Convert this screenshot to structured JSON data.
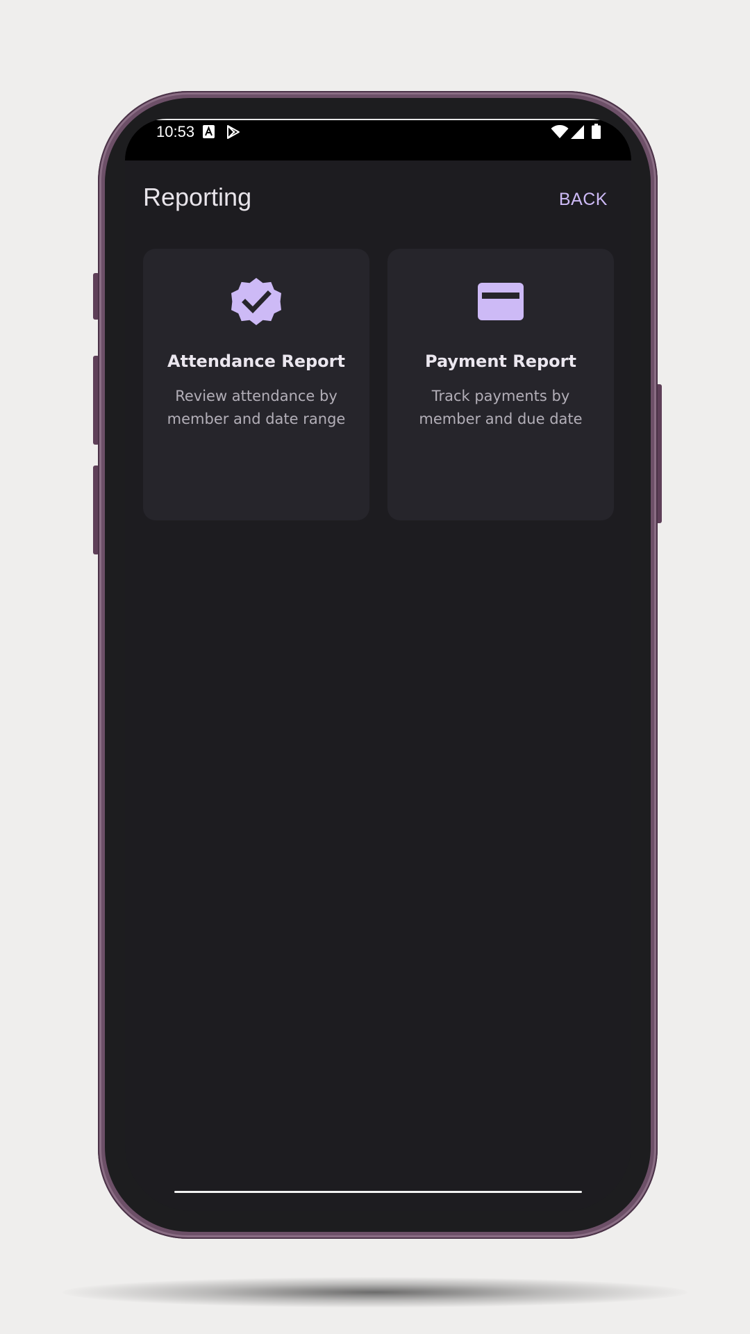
{
  "status_bar": {
    "time": "10:53",
    "left_icons": [
      "font-a-icon",
      "play-store-icon"
    ],
    "right_icons": [
      "wifi-icon",
      "cell-signal-icon",
      "battery-icon"
    ]
  },
  "app_bar": {
    "title": "Reporting",
    "back_label": "BACK"
  },
  "cards": [
    {
      "icon": "verified-badge-icon",
      "title": "Attendance Report",
      "description": "Review attendance by member and date range"
    },
    {
      "icon": "credit-card-icon",
      "title": "Payment Report",
      "description": "Track payments by member and due date"
    }
  ],
  "colors": {
    "accent": "#cdbaf6",
    "background": "#1d1c20",
    "card": "#26252b",
    "device_frame": "#6d5068"
  }
}
